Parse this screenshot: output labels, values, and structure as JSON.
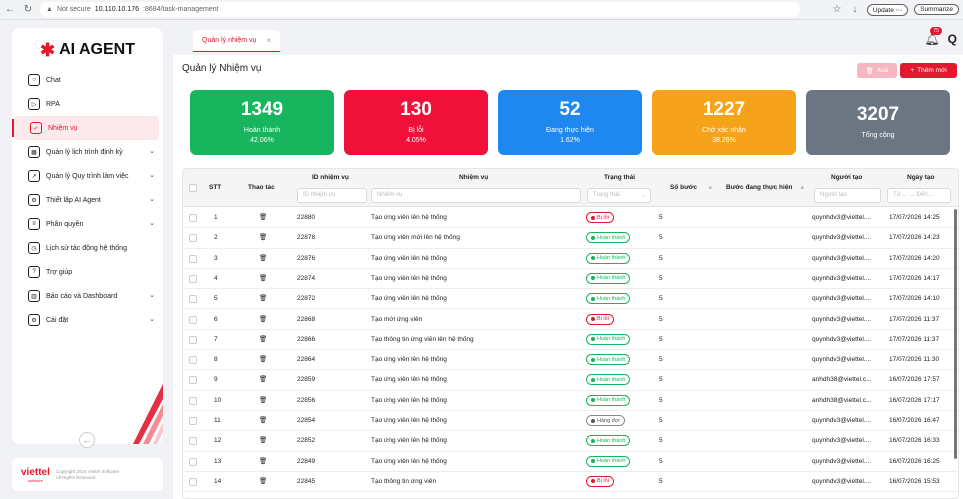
{
  "browser": {
    "not_secure": "Not secure",
    "url_host": "10.110.10.176",
    "url_rest": ":8684/task-management",
    "update": "Update",
    "summarize": "Summarize"
  },
  "sidebar": {
    "logo_text": "AI AGENT",
    "items": [
      {
        "label": "Chat",
        "icon": "chat-icon",
        "chevron": false,
        "active": false
      },
      {
        "label": "RPA",
        "icon": "play-icon",
        "chevron": false,
        "active": false
      },
      {
        "label": "Nhiệm vụ",
        "icon": "clipboard-icon",
        "chevron": false,
        "active": true
      },
      {
        "label": "Quản lý lịch trình định kỳ",
        "icon": "calendar-icon",
        "chevron": true,
        "active": false
      },
      {
        "label": "Quản lý Quy trình làm việc",
        "icon": "trend-icon",
        "chevron": true,
        "active": false
      },
      {
        "label": "Thiết lập AI Agent",
        "icon": "gear-box-icon",
        "chevron": true,
        "active": false
      },
      {
        "label": "Phân quyền",
        "icon": "sliders-icon",
        "chevron": true,
        "active": false
      },
      {
        "label": "Lịch sử tác động hệ thống",
        "icon": "history-icon",
        "chevron": false,
        "active": false
      },
      {
        "label": "Trợ giúp",
        "icon": "help-icon",
        "chevron": false,
        "active": false
      },
      {
        "label": "Báo cáo và Dashboard",
        "icon": "report-icon",
        "chevron": true,
        "active": false
      },
      {
        "label": "Cài đặt",
        "icon": "settings-icon",
        "chevron": true,
        "active": false
      }
    ],
    "footer_brand": "viettel",
    "footer_sub": "software",
    "footer_copy1": "Copyright 2024 Viettel Software",
    "footer_copy2": "All Rights Reserved"
  },
  "tab": {
    "label": "Quản lý nhiệm vụ"
  },
  "header": {
    "badge": "75",
    "user_initial": "Q"
  },
  "page": {
    "title": "Quản lý Nhiệm vụ",
    "delete_label": "Xoá",
    "add_label": "Thêm mới"
  },
  "stats": [
    {
      "value": "1349",
      "label": "Hoàn thành",
      "pct": "42.06%",
      "color": "#17b55d"
    },
    {
      "value": "130",
      "label": "Bị lỗi",
      "pct": "4.05%",
      "color": "#f0113a"
    },
    {
      "value": "52",
      "label": "Đang thực hiện",
      "pct": "1.62%",
      "color": "#1e88f0"
    },
    {
      "value": "1227",
      "label": "Chờ xác nhận",
      "pct": "38.26%",
      "color": "#f6a21b"
    },
    {
      "value": "3207",
      "label": "Tổng cộng",
      "pct": "",
      "color": "#6c7683"
    }
  ],
  "table": {
    "headers": {
      "stt": "STT",
      "action": "Thao tác",
      "id": "ID nhiệm vụ",
      "task": "Nhiệm vụ",
      "status": "Trạng thái",
      "steps": "Số bước",
      "current": "Bước đang thực hiện",
      "creator": "Người tạo",
      "date": "Ngày tạo"
    },
    "filters": {
      "id": "ID nhiệm vụ",
      "task": "Nhiệm vụ",
      "status": "Trạng thái",
      "creator": "Người tạo",
      "date_from": "Từ ...",
      "date_to": "Đến..."
    },
    "rows": [
      {
        "stt": "1",
        "id": "22880",
        "task": "Tạo ứng viên lên hệ thống",
        "status": "Bị lỗi",
        "type": "err",
        "steps": "5",
        "creator": "quynhdv3@viettel....",
        "date": "17/07/2026 14:25"
      },
      {
        "stt": "2",
        "id": "22878",
        "task": "Tạo ứng viên mới lên hệ thống",
        "status": "Hoàn thành",
        "type": "ok",
        "steps": "5",
        "creator": "quynhdv3@viettel....",
        "date": "17/07/2026 14:23"
      },
      {
        "stt": "3",
        "id": "22876",
        "task": "Tạo ứng viên lên hệ thống",
        "status": "Hoàn thành",
        "type": "ok",
        "steps": "5",
        "creator": "quynhdv3@viettel....",
        "date": "17/07/2026 14:20"
      },
      {
        "stt": "4",
        "id": "22874",
        "task": "Tạo ứng viên lên hệ thống",
        "status": "Hoàn thành",
        "type": "ok",
        "steps": "5",
        "creator": "quynhdv3@viettel....",
        "date": "17/07/2026 14:17"
      },
      {
        "stt": "5",
        "id": "22872",
        "task": "Tạo ứng viên lên hệ thống",
        "status": "Hoàn thành",
        "type": "ok",
        "steps": "5",
        "creator": "quynhdv3@viettel....",
        "date": "17/07/2026 14:10"
      },
      {
        "stt": "6",
        "id": "22868",
        "task": "Tạo mới ứng viên",
        "status": "Bị lỗi",
        "type": "err",
        "steps": "5",
        "creator": "quynhdv3@viettel....",
        "date": "17/07/2026 11:37"
      },
      {
        "stt": "7",
        "id": "22866",
        "task": "Tạo thông tin ứng viên lên hệ thống",
        "status": "Hoàn thành",
        "type": "ok",
        "steps": "5",
        "creator": "quynhdv3@viettel....",
        "date": "17/07/2026 11:37"
      },
      {
        "stt": "8",
        "id": "22864",
        "task": "Tạo ứng viên lên hệ thống",
        "status": "Hoàn thành",
        "type": "ok",
        "steps": "5",
        "creator": "quynhdv3@viettel....",
        "date": "17/07/2026 11:30"
      },
      {
        "stt": "9",
        "id": "22859",
        "task": "Tạo ứng viên lên hệ thống",
        "status": "Hoàn thành",
        "type": "ok",
        "steps": "5",
        "creator": "anhdh38@viettel.c...",
        "date": "16/07/2026 17:57"
      },
      {
        "stt": "10",
        "id": "22856",
        "task": "Tạo ứng viên lên hệ thống",
        "status": "Hoàn thành",
        "type": "ok",
        "steps": "5",
        "creator": "anhdh38@viettel.c...",
        "date": "16/07/2026 17:17"
      },
      {
        "stt": "11",
        "id": "22854",
        "task": "Tạo ứng viên lên hệ thống",
        "status": "Hàng đợi",
        "type": "queue",
        "steps": "5",
        "creator": "quynhdv3@viettel....",
        "date": "16/07/2026 16:47"
      },
      {
        "stt": "12",
        "id": "22852",
        "task": "Tạo ứng viên lên hệ thống",
        "status": "Hoàn thành",
        "type": "ok",
        "steps": "5",
        "creator": "quynhdv3@viettel....",
        "date": "16/07/2026 16:33"
      },
      {
        "stt": "13",
        "id": "22849",
        "task": "Tạo ứng viên lên hệ thống",
        "status": "Hoàn thành",
        "type": "ok",
        "steps": "5",
        "creator": "quynhdv3@viettel....",
        "date": "16/07/2026 16:25"
      },
      {
        "stt": "14",
        "id": "22845",
        "task": "Tạo thông tin ứng viên",
        "status": "Bị lỗi",
        "type": "err",
        "steps": "5",
        "creator": "quynhdv3@viettel....",
        "date": "16/07/2026 15:53"
      }
    ]
  },
  "colors": {
    "accent": "#e0192e",
    "ok": "#17b55d",
    "err": "#e0192e",
    "queue": "#555555"
  }
}
